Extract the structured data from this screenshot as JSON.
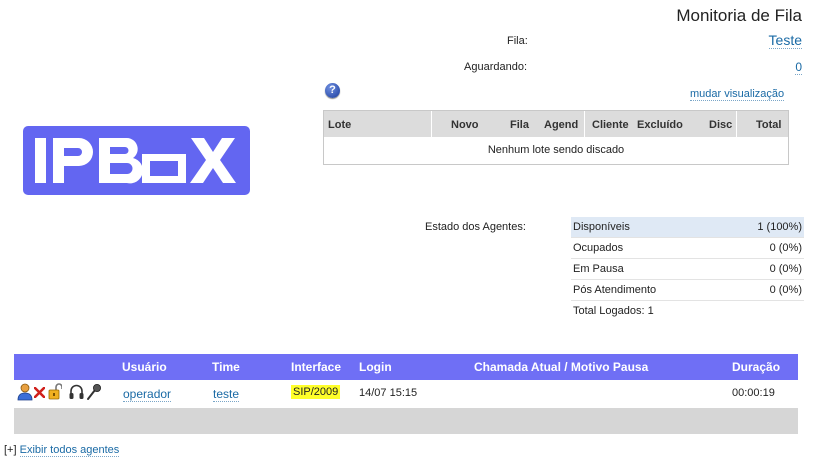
{
  "header": {
    "title": "Monitoria de Fila"
  },
  "fila": {
    "label": "Fila:",
    "value": "Teste"
  },
  "aguardando": {
    "label": "Aguardando:",
    "value": "0"
  },
  "view_toggle": "mudar visualização",
  "help_glyph": "?",
  "lotes": {
    "columns": [
      "Lote",
      "Novo",
      "Fila",
      "Agend",
      "Cliente",
      "Excluído",
      "Disc",
      "Total"
    ],
    "empty_message": "Nenhum lote sendo discado"
  },
  "logo": {
    "text": "IPBOX",
    "color": "#6366f1"
  },
  "estado_agentes": {
    "label": "Estado dos Agentes:",
    "rows": [
      {
        "name": "Disponíveis",
        "value": "1 (100%)"
      },
      {
        "name": "Ocupados",
        "value": "0 (0%)"
      },
      {
        "name": "Em Pausa",
        "value": "0 (0%)"
      },
      {
        "name": "Pós Atendimento",
        "value": "0 (0%)"
      }
    ],
    "total": "Total Logados: 1"
  },
  "agents_table": {
    "header_color": "#6f6ff5",
    "columns": [
      "Usuário",
      "Time",
      "Interface",
      "Login",
      "Chamada Atual / Motivo Pausa",
      "Duração"
    ],
    "rows": [
      {
        "usuario": "operador",
        "time": "teste",
        "interface": "SIP/2009",
        "login": "14/07 15:15",
        "chamada": "",
        "duracao": "00:00:19",
        "icons": [
          "agent-user-icon",
          "logout-x-icon",
          "unlock-icon",
          "headset-icon",
          "microphone-icon"
        ]
      }
    ]
  },
  "footer": {
    "prefix": "[+]",
    "link": "Exibir todos agentes"
  }
}
